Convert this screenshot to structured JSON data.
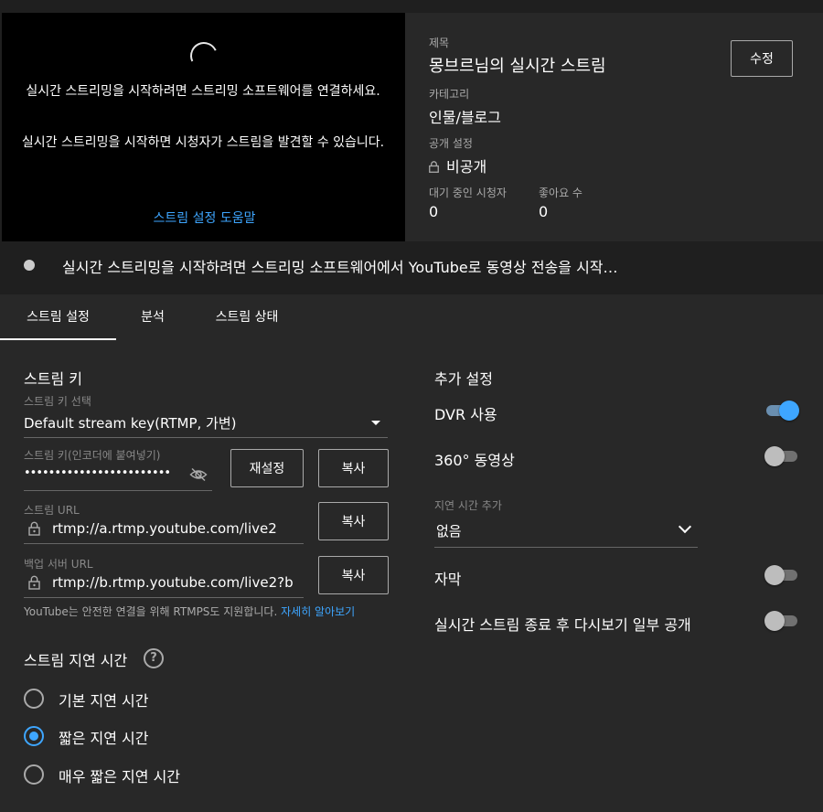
{
  "preview": {
    "message1": "실시간 스트리밍을 시작하려면 스트리밍 소프트웨어를 연결하세요.",
    "message2": "실시간 스트리밍을 시작하면 시청자가 스트림을 발견할 수 있습니다.",
    "help_link": "스트림 설정 도움말"
  },
  "info": {
    "title_label": "제목",
    "title_value": "몽브르님의 실시간 스트림",
    "edit_button": "수정",
    "category_label": "카테고리",
    "category_value": "인물/블로그",
    "visibility_label": "공개 설정",
    "visibility_value": "비공개",
    "waiting_label": "대기 중인 시청자",
    "waiting_value": "0",
    "likes_label": "좋아요 수",
    "likes_value": "0"
  },
  "banner": {
    "text": "실시간 스트리밍을 시작하려면 스트리밍 소프트웨어에서 YouTube로 동영상 전송을 시작…"
  },
  "tabs": [
    {
      "label": "스트림 설정",
      "active": true
    },
    {
      "label": "분석",
      "active": false
    },
    {
      "label": "스트림 상태",
      "active": false
    }
  ],
  "stream_key": {
    "section_title": "스트림 키",
    "select_label": "스트림 키 선택",
    "select_value": "Default stream key(RTMP, 가변)",
    "key_label": "스트림 키(인코더에 붙여넣기)",
    "key_value": "••••••••••••••••••••••••",
    "reset_button": "재설정",
    "copy_button": "복사",
    "url_label": "스트림 URL",
    "url_value": "rtmp://a.rtmp.youtube.com/live2",
    "backup_label": "백업 서버 URL",
    "backup_value": "rtmp://b.rtmp.youtube.com/live2?b",
    "note_text": "YouTube는 안전한 연결을 위해 RTMPS도 지원합니다. ",
    "note_link": "자세히 알아보기"
  },
  "latency": {
    "section_title": "스트림 지연 시간",
    "options": [
      {
        "label": "기본 지연 시간",
        "checked": false
      },
      {
        "label": "짧은 지연 시간",
        "checked": true
      },
      {
        "label": "매우 짧은 지연 시간",
        "checked": false
      }
    ]
  },
  "additional": {
    "section_title": "추가 설정",
    "dvr_label": "DVR 사용",
    "dvr_on": true,
    "video360_label": "360° 동영상",
    "video360_on": false,
    "delay_label": "지연 시간 추가",
    "delay_value": "없음",
    "captions_label": "자막",
    "captions_on": false,
    "replay_label": "실시간 스트림 종료 후 다시보기 일부 공개",
    "replay_on": false
  },
  "colors": {
    "accent": "#3ea6ff",
    "panel": "#282828",
    "background": "#1f1f1f"
  }
}
